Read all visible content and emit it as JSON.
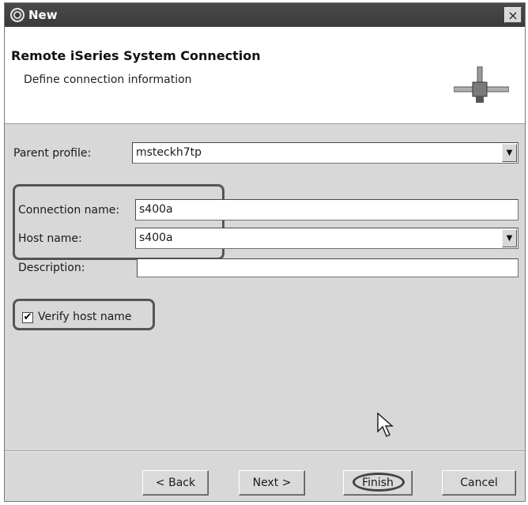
{
  "window": {
    "title": "New",
    "close_glyph": "×",
    "app_icon": "eclipse-icon"
  },
  "banner": {
    "title": "Remote iSeries System Connection",
    "subtitle": "Define connection information",
    "graphic_icon": "connection-wizard-icon"
  },
  "form": {
    "parent_profile": {
      "label": "Parent profile:",
      "value": "msteckh7tp"
    },
    "connection_name": {
      "label": "Connection name:",
      "value": "s400a"
    },
    "host_name": {
      "label": "Host name:",
      "value": "s400a"
    },
    "description": {
      "label": "Description:",
      "value": ""
    },
    "verify_host": {
      "label": "Verify host name",
      "checked": true,
      "check_glyph": "✔"
    }
  },
  "buttons": {
    "back": "< Back",
    "next": "Next >",
    "finish": "Finish",
    "cancel": "Cancel"
  },
  "dropdown_glyph": "▼",
  "colors": {
    "titlebar": "#3a3a3a",
    "dialog_bg": "#d8d8d8",
    "annotation": "#555555"
  }
}
